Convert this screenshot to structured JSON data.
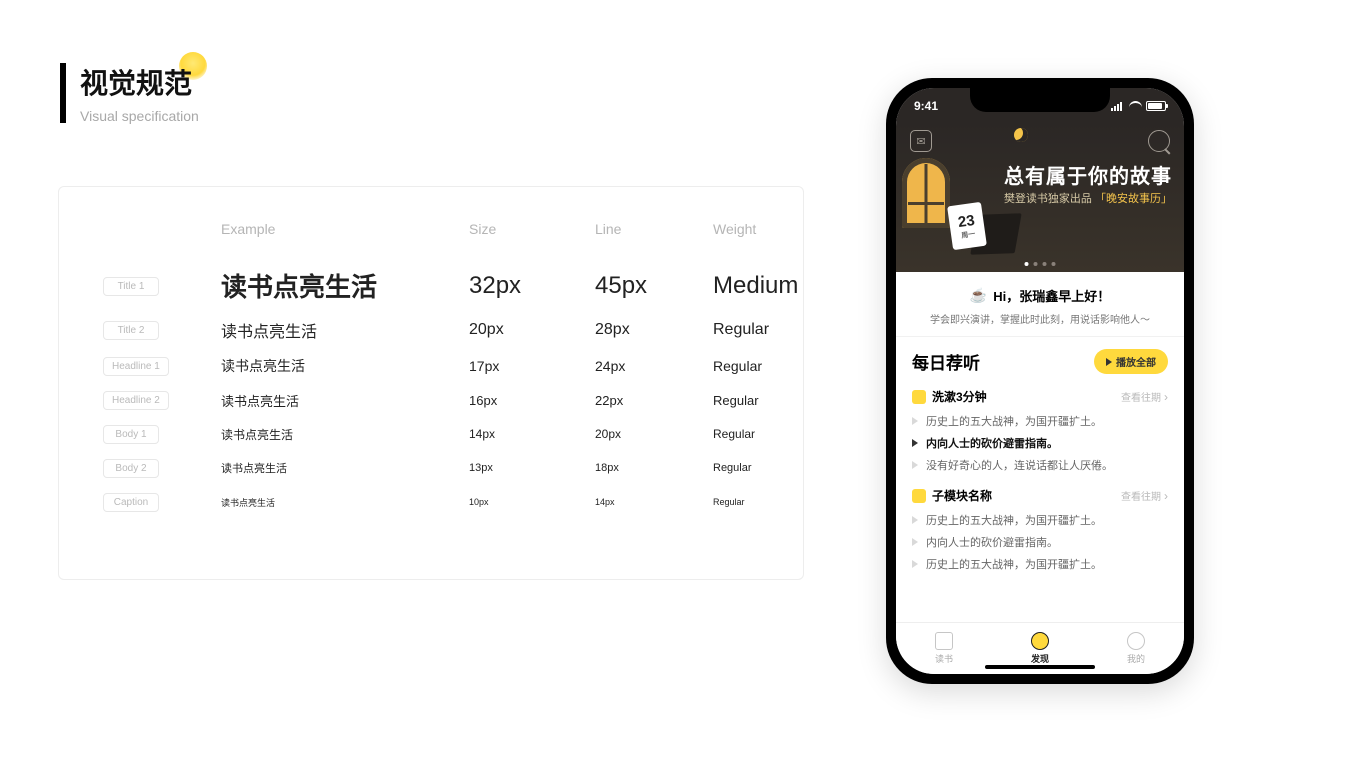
{
  "header": {
    "title": "视觉规范",
    "subtitle": "Visual specification"
  },
  "spec": {
    "columns": {
      "example": "Example",
      "size": "Size",
      "line": "Line",
      "weight": "Weight"
    },
    "rows": [
      {
        "label": "Title 1",
        "example": "读书点亮生活",
        "size": "32px",
        "line": "45px",
        "weight": "Medium"
      },
      {
        "label": "Title 2",
        "example": "读书点亮生活",
        "size": "20px",
        "line": "28px",
        "weight": "Regular"
      },
      {
        "label": "Headline 1",
        "example": "读书点亮生活",
        "size": "17px",
        "line": "24px",
        "weight": "Regular"
      },
      {
        "label": "Headline 2",
        "example": "读书点亮生活",
        "size": "16px",
        "line": "22px",
        "weight": "Regular"
      },
      {
        "label": "Body 1",
        "example": "读书点亮生活",
        "size": "14px",
        "line": "20px",
        "weight": "Regular"
      },
      {
        "label": "Body 2",
        "example": "读书点亮生活",
        "size": "13px",
        "line": "18px",
        "weight": "Regular"
      },
      {
        "label": "Caption",
        "example": "读书点亮生活",
        "size": "10px",
        "line": "14px",
        "weight": "Regular"
      }
    ]
  },
  "phone": {
    "status_time": "9:41",
    "hero": {
      "title": "总有属于你的故事",
      "subtitle_prefix": "樊登读书独家出品",
      "subtitle_tag": "「晚安故事历」",
      "calendar_day": "23",
      "calendar_sub": "周一"
    },
    "greeting": {
      "line": "Hi，张瑞鑫早上好！",
      "sub": "学会即兴演讲，掌握此时此刻，用说话影响他人～"
    },
    "daily": {
      "title": "每日荐听",
      "play_all": "播放全部",
      "more_label": "查看往期",
      "modules": [
        {
          "name": "洗漱3分钟",
          "items": [
            {
              "text": "历史上的五大战神，为国开疆扩土。",
              "strong": false
            },
            {
              "text": "内向人士的砍价避雷指南。",
              "strong": true
            },
            {
              "text": "没有好奇心的人，连说话都让人厌倦。",
              "strong": false
            }
          ]
        },
        {
          "name": "子模块名称",
          "items": [
            {
              "text": "历史上的五大战神，为国开疆扩土。",
              "strong": false
            },
            {
              "text": "内向人士的砍价避雷指南。",
              "strong": false
            },
            {
              "text": "历史上的五大战神，为国开疆扩土。",
              "strong": false
            }
          ]
        }
      ]
    },
    "tabs": [
      {
        "label": "读书",
        "active": false
      },
      {
        "label": "发现",
        "active": true
      },
      {
        "label": "我的",
        "active": false
      }
    ]
  }
}
